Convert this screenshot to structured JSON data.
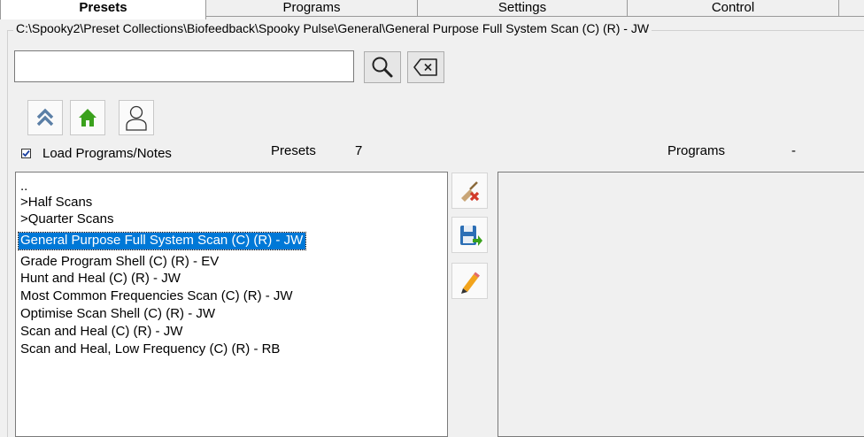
{
  "tabs": [
    {
      "label": "Presets",
      "active": true
    },
    {
      "label": "Programs",
      "active": false
    },
    {
      "label": "Settings",
      "active": false
    },
    {
      "label": "Control",
      "active": false
    }
  ],
  "path": "C:\\Spooky2\\Preset Collections\\Biofeedback\\Spooky Pulse\\General\\General Purpose Full System Scan (C) (R) - JW",
  "search": {
    "value": "",
    "placeholder": ""
  },
  "icons": {
    "search": "magnifier-icon",
    "clear": "backspace-clear-icon",
    "up": "double-chevron-up-icon",
    "home": "home-icon",
    "user": "user-icon",
    "delete": "broom-delete-icon",
    "save": "save-icon",
    "edit": "pencil-icon"
  },
  "load_programs": {
    "label": "Load Programs/Notes",
    "checked": true
  },
  "presets_count": {
    "label": "Presets",
    "value": "7"
  },
  "programs_count": {
    "label": "Programs",
    "value": "-"
  },
  "preset_list": [
    "..",
    ">Half Scans",
    ">Quarter Scans",
    "General Purpose Full System Scan (C) (R) - JW",
    "Grade Program Shell (C) (R) - EV",
    "Hunt and Heal (C) (R) - JW",
    "Most Common Frequencies Scan (C) (R) - JW",
    "Optimise Scan Shell (C) (R) - JW",
    "Scan and Heal (C) (R) - JW",
    "Scan and Heal, Low Frequency (C) (R) - RB"
  ],
  "selected_index": 3,
  "colors": {
    "selection": "#0078d7",
    "home_green": "#3aa11c",
    "chevron": "#5b7fa6"
  }
}
